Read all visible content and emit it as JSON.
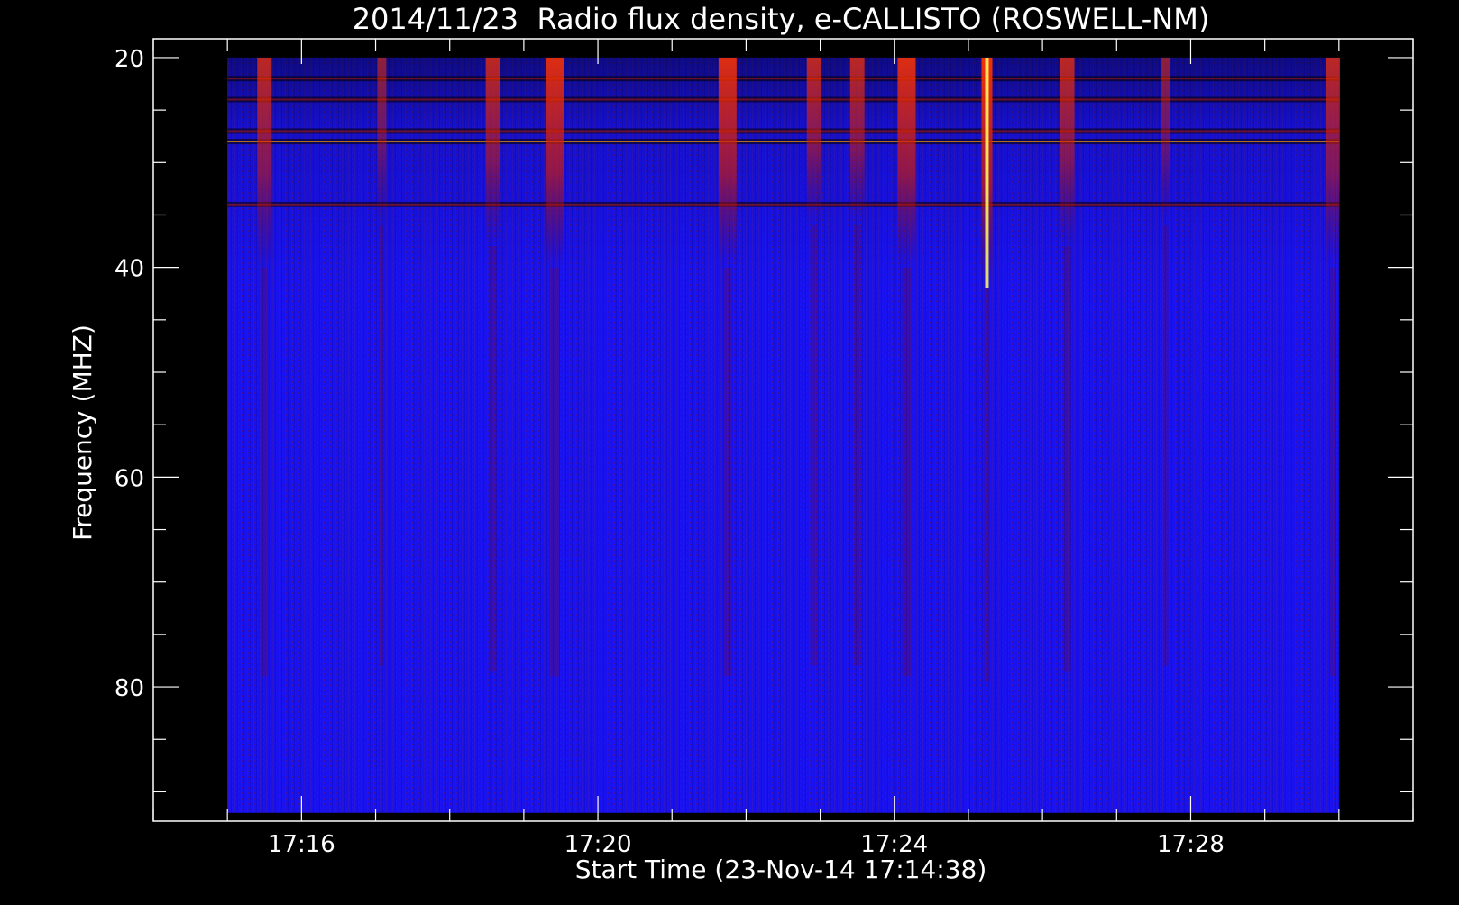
{
  "chart_data": {
    "type": "heatmap",
    "title": "2014/11/23  Radio flux density, e-CALLISTO (ROSWELL-NM)",
    "xlabel": "Start Time (23-Nov-14 17:14:38)",
    "ylabel": "Frequency (MHZ)",
    "x_axis": {
      "unit": "time (UT)",
      "range": [
        "17:14:00",
        "17:31:00"
      ],
      "data_range": [
        "17:15:00",
        "17:30:00"
      ],
      "major_ticks": [
        "17:16",
        "17:20",
        "17:24",
        "17:28"
      ],
      "minor_tick_interval_min": 1
    },
    "y_axis": {
      "unit": "MHz",
      "range": [
        18.2,
        92.8
      ],
      "data_range": [
        20,
        92
      ],
      "inverted": true,
      "major_ticks": [
        20,
        40,
        60,
        80
      ],
      "minor_tick_interval": 5
    },
    "colormap": [
      "#000000",
      "#0000ff",
      "#8b0000",
      "#ff3300",
      "#ff9900",
      "#ffff66"
    ],
    "background_level": "blue",
    "bursts": [
      {
        "time": "17:15:30",
        "freq_range": [
          20,
          40
        ],
        "intensity": "moderate"
      },
      {
        "time": "17:17:05",
        "freq_range": [
          20,
          36
        ],
        "intensity": "weak"
      },
      {
        "time": "17:18:35",
        "freq_range": [
          20,
          38
        ],
        "intensity": "moderate"
      },
      {
        "time": "17:19:25",
        "freq_range": [
          20,
          40
        ],
        "intensity": "strong"
      },
      {
        "time": "17:21:45",
        "freq_range": [
          20,
          40
        ],
        "intensity": "strong"
      },
      {
        "time": "17:22:55",
        "freq_range": [
          20,
          36
        ],
        "intensity": "moderate"
      },
      {
        "time": "17:23:30",
        "freq_range": [
          20,
          36
        ],
        "intensity": "moderate"
      },
      {
        "time": "17:24:10",
        "freq_range": [
          20,
          40
        ],
        "intensity": "strong"
      },
      {
        "time": "17:25:15",
        "freq_range": [
          20,
          42
        ],
        "intensity": "very strong"
      },
      {
        "time": "17:26:20",
        "freq_range": [
          20,
          38
        ],
        "intensity": "moderate"
      },
      {
        "time": "17:27:40",
        "freq_range": [
          20,
          36
        ],
        "intensity": "weak"
      },
      {
        "time": "17:29:55",
        "freq_range": [
          20,
          40
        ],
        "intensity": "moderate"
      }
    ],
    "horizontal_bands_mhz": [
      22,
      24,
      27,
      28,
      34
    ]
  }
}
